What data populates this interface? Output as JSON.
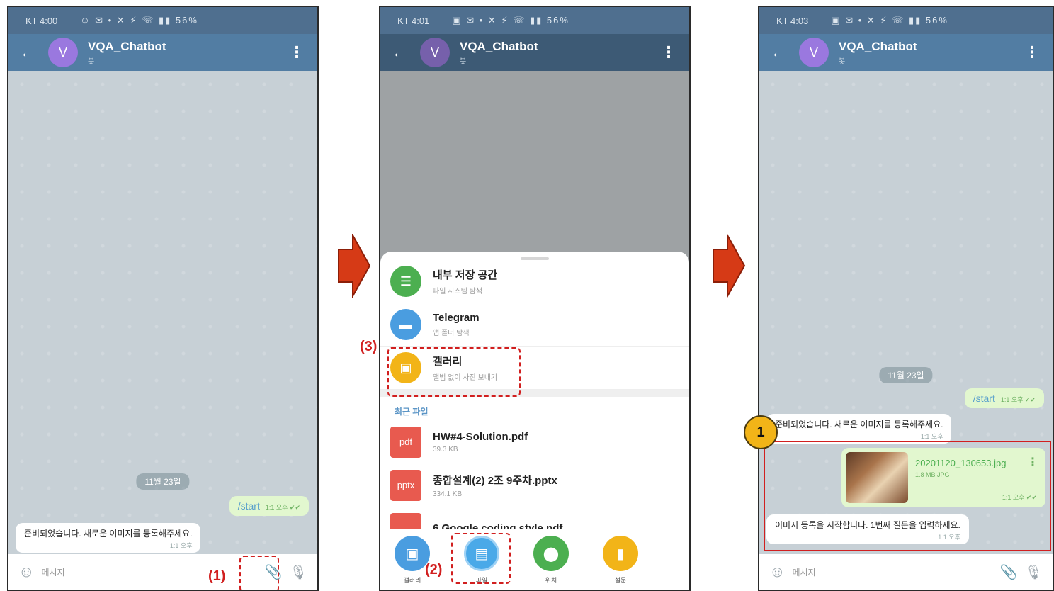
{
  "screens": [
    {
      "status": "KT 4:00",
      "status_icons": "☺ ✉ •    ✕ ⚡ ☏ ▮▮ 56%",
      "chat_title": "VQA_Chatbot",
      "chat_sub": "봇",
      "avatar_letter": "V",
      "date_chip": "11월 23일",
      "out_message": "/start",
      "out_time": "1:1 오후 ✔✔",
      "in_message": "준비되었습니다. 새로운 이미지를 등록해주세요.",
      "in_time": "1:1 오후",
      "input_placeholder": "메시지",
      "annotation": "(1)"
    },
    {
      "status": "KT 4:01",
      "status_icons": "▣ ✉ •    ✕ ⚡ ☏ ▮▮ 56%",
      "chat_title": "VQA_Chatbot",
      "chat_sub": "봇",
      "avatar_letter": "V",
      "sheet_rows": [
        {
          "title": "내부 저장 공간",
          "sub": "파일 시스템 탐색"
        },
        {
          "title": "Telegram",
          "sub": "앱 폴더 탐색"
        },
        {
          "title": "갤러리",
          "sub": "앨범 없이 사진 보내기"
        }
      ],
      "recent_label": "최근 파일",
      "files": [
        {
          "ext": "pdf",
          "name": "HW#4-Solution.pdf",
          "size": "39.3 KB"
        },
        {
          "ext": "pptx",
          "name": "종합설계(2) 2조 9주차.pptx",
          "size": "334.1 KB"
        },
        {
          "ext": "",
          "name": "6 Google coding style.pdf",
          "size": ""
        }
      ],
      "tabs": [
        {
          "label": "갤러리"
        },
        {
          "label": "파일"
        },
        {
          "label": "위치"
        },
        {
          "label": "설문"
        }
      ],
      "annotation2": "(2)",
      "annotation3": "(3)"
    },
    {
      "status": "KT 4:03",
      "status_icons": "▣ ✉ •    ✕ ⚡ ☏ ▮▮ 56%",
      "chat_title": "VQA_Chatbot",
      "chat_sub": "봇",
      "avatar_letter": "V",
      "date_chip": "11월 23일",
      "out_message": "/start",
      "out_time": "1:1 오후 ✔✔",
      "in_message": "준비되었습니다. 새로운 이미지를 등록해주세요.",
      "in_time": "1:1 오후",
      "photo_name": "20201120_130653.jpg",
      "photo_size": "1.8 MB JPG",
      "photo_time": "1:1 오후 ✔✔",
      "reply_message": "이미지 등록을 시작합니다. 1번째 질문을 입력하세요.",
      "reply_time": "1:1 오후",
      "input_placeholder": "메시지",
      "badge": "1"
    }
  ],
  "colors": {
    "header": "#527da3",
    "annotation_red": "#d11f1f",
    "arrow_red": "#d63a16",
    "badge_yellow": "#f2b418"
  }
}
